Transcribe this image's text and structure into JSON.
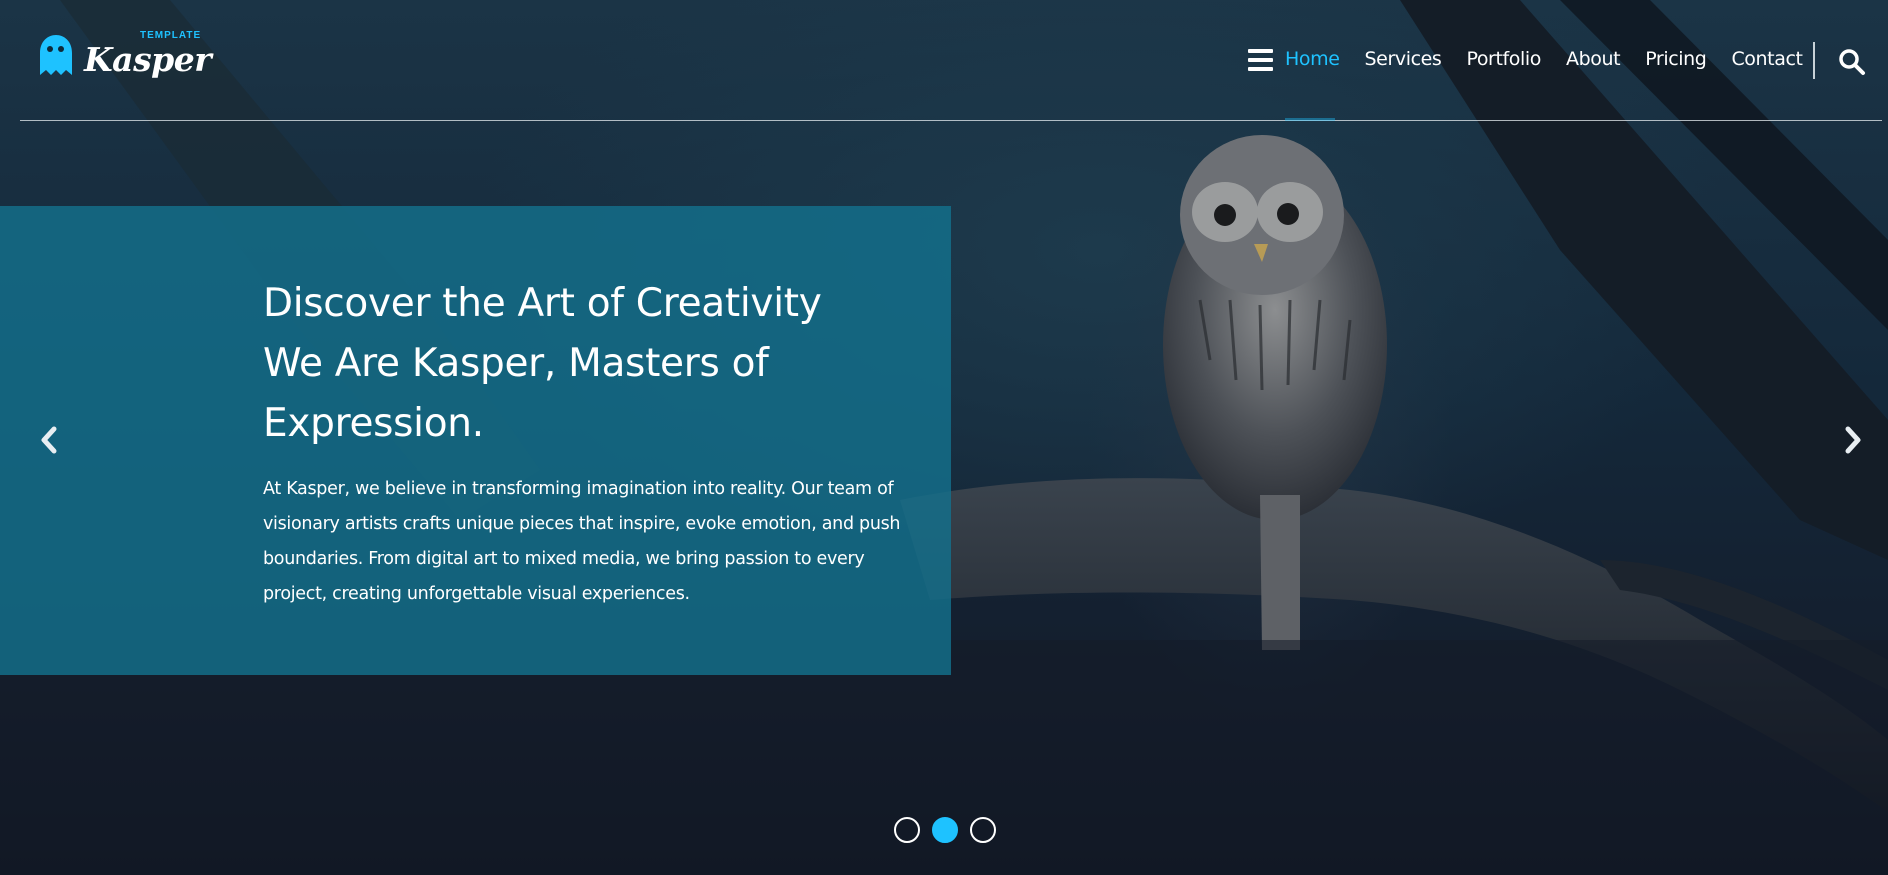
{
  "brand": {
    "name": "Kasper",
    "tag": "TEMPLATE",
    "accent_color": "#1ec2ff"
  },
  "nav": {
    "menu_icon": "hamburger-icon",
    "items": [
      {
        "label": "Home",
        "active": true
      },
      {
        "label": "Services",
        "active": false
      },
      {
        "label": "Portfolio",
        "active": false
      },
      {
        "label": "About",
        "active": false
      },
      {
        "label": "Pricing",
        "active": false
      },
      {
        "label": "Contact",
        "active": false
      }
    ],
    "search_icon": "search-icon"
  },
  "hero": {
    "title_lines": [
      "Discover the Art of Creativity",
      "We Are Kasper, Masters of",
      "Expression."
    ],
    "description": "At Kasper, we believe in transforming imagination into reality. Our team of visionary artists crafts unique pieces that inspire, evoke emotion, and push boundaries. From digital art to mixed media, we bring passion to every project, creating unforgettable visual experiences.",
    "panel_color": "#14708c",
    "prev_icon": "chevron-left-icon",
    "next_icon": "chevron-right-icon"
  },
  "slider": {
    "slides": 3,
    "active_index": 1
  }
}
